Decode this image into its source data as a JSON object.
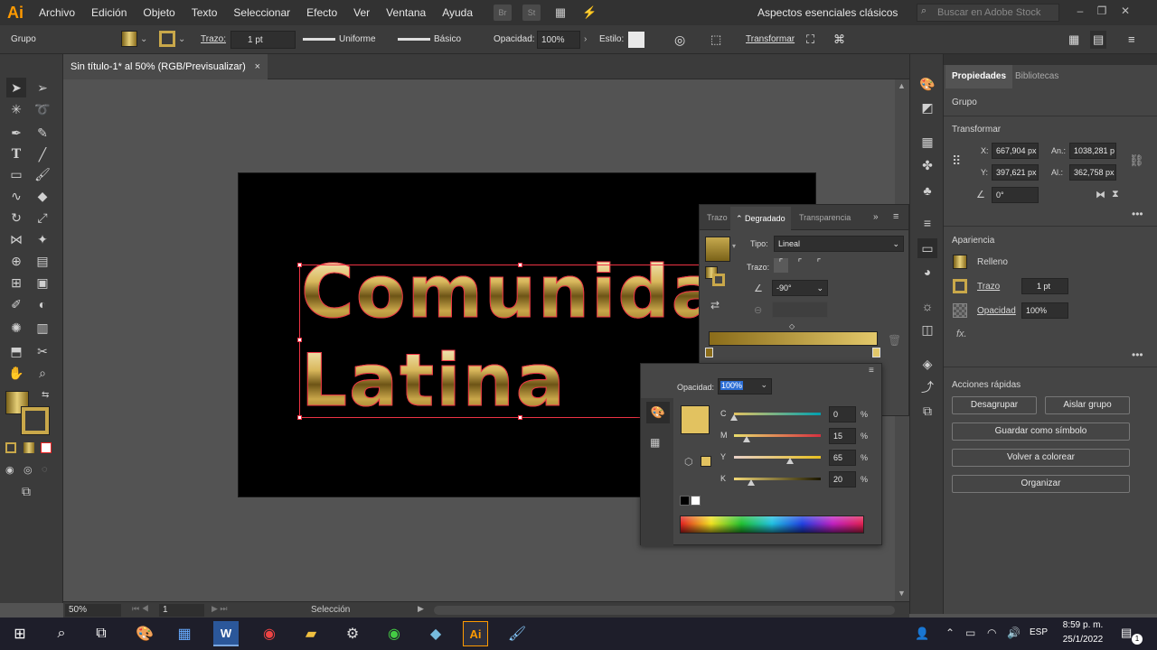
{
  "app": {
    "logo": "Ai",
    "accent": "#ff9a00"
  },
  "menu": [
    "Archivo",
    "Edición",
    "Objeto",
    "Texto",
    "Seleccionar",
    "Efecto",
    "Ver",
    "Ventana",
    "Ayuda"
  ],
  "menu_icons": [
    "Br",
    "St"
  ],
  "workspace": "Aspectos esenciales clásicos",
  "stock_search_placeholder": "Buscar en Adobe Stock",
  "control": {
    "selection_type": "Grupo",
    "stroke_label": "Trazo:",
    "stroke_weight": "1 pt",
    "profile": "Uniforme",
    "brush": "Básico",
    "opacity_label": "Opacidad:",
    "opacity": "100%",
    "style_label": "Estilo:",
    "transform": "Transformar"
  },
  "document_tab": {
    "title": "Sin título-1* al 50% (RGB/Previsualizar)",
    "close": "×"
  },
  "artwork": {
    "line1": "Comunidad",
    "line2": "Latina"
  },
  "status": {
    "zoom": "50%",
    "page": "1",
    "tool": "Selección"
  },
  "gradient_panel": {
    "tabs": [
      "Trazo",
      "Degradado",
      "Transparencia"
    ],
    "type_label": "Tipo:",
    "type": "Lineal",
    "stroke_label": "Trazo:",
    "angle": "-90°",
    "gradient_colors": [
      "#8a6c1a",
      "#e3c86a"
    ]
  },
  "color_panel": {
    "opacity_label": "Opacidad:",
    "opacity": "100%",
    "swatch": "#e2c260",
    "channels": [
      {
        "label": "C",
        "value": "0",
        "unit": "%",
        "level": 0.0
      },
      {
        "label": "M",
        "value": "15",
        "unit": "%",
        "level": 0.15
      },
      {
        "label": "Y",
        "value": "65",
        "unit": "%",
        "level": 0.65
      },
      {
        "label": "K",
        "value": "20",
        "unit": "%",
        "level": 0.2
      }
    ]
  },
  "properties": {
    "tabs": [
      "Propiedades",
      "Bibliotecas"
    ],
    "object_type": "Grupo",
    "transform_title": "Transformar",
    "x_label": "X:",
    "x": "667,904 px",
    "y_label": "Y:",
    "y": "397,621 px",
    "w_label": "An.:",
    "w": "1038,281 p",
    "h_label": "Al.:",
    "h": "362,758 px",
    "angle": "0°",
    "appearance_title": "Apariencia",
    "fill": "Relleno",
    "stroke": "Trazo",
    "stroke_weight": "1 pt",
    "opacity": "Opacidad",
    "opacity_value": "100%",
    "fx": "fx.",
    "quick_actions_title": "Acciones rápidas",
    "buttons": [
      "Desagrupar",
      "Aislar grupo",
      "Guardar como símbolo",
      "Volver a colorear",
      "Organizar"
    ]
  },
  "taskbar": {
    "lang": "ESP",
    "time": "8:59 p. m.",
    "date": "25/1/2022",
    "notifications": "1"
  }
}
